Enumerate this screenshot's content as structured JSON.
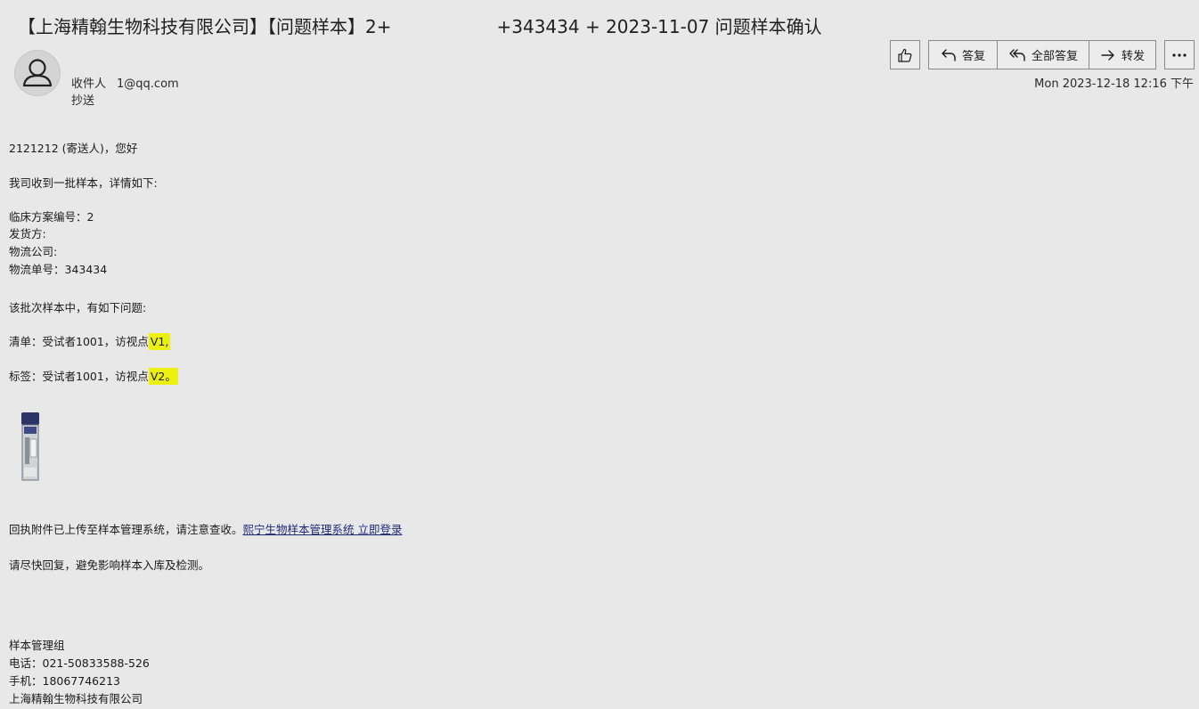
{
  "email": {
    "subject_left": "【上海精翰生物科技有限公司】【问题样本】2+",
    "subject_right": "+343434 + 2023-11-07 问题样本确认",
    "to_label": "收件人",
    "to_address": "1@qq.com",
    "cc_label": "抄送",
    "timestamp": "Mon 2023-12-18 12:16 下午"
  },
  "toolbar": {
    "like_icon": "thumbs-up-icon",
    "reply_label": "答复",
    "reply_all_label": "全部答复",
    "forward_label": "转发",
    "more_icon": "more-dots-icon"
  },
  "body": {
    "greeting": "2121212 (寄送人)，您好",
    "intro": "我司收到一批样本，详情如下:",
    "protocol": "临床方案编号：2",
    "shipper": "发货方:",
    "logistics_company": "物流公司:",
    "tracking": "物流单号：343434",
    "issues_intro": "该批次样本中，有如下问题:",
    "list_prefix": "清单：受试者1001，访视点",
    "list_highlight": "V1,",
    "label_prefix": "标签：受试者1001，访视点",
    "label_highlight": "V2。",
    "receipt_text": "回执附件已上传至样本管理系统，请注意查收。",
    "receipt_link": "熙宁生物样本管理系统 立即登录",
    "reminder": "请尽快回复，避免影响样本入库及检测。",
    "sig_team": "样本管理组",
    "sig_phone": "电话：021-50833588-526",
    "sig_mobile": "手机：18067746213",
    "sig_company": "上海精翰生物科技有限公司"
  }
}
